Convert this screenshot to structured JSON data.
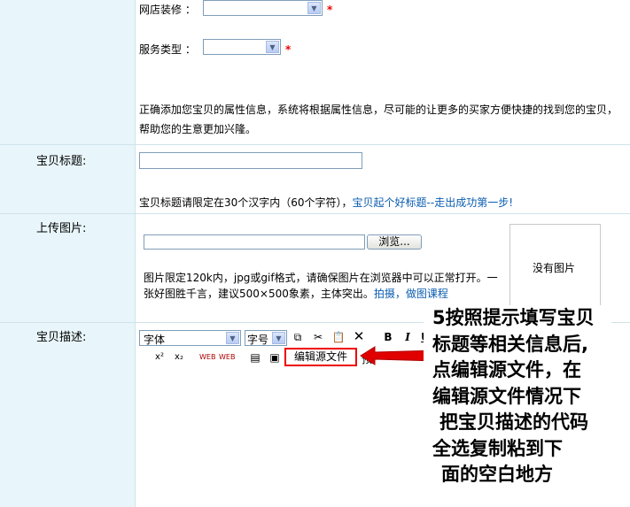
{
  "shop_decor": {
    "label": "网店装修 ：",
    "required": "*"
  },
  "service_type": {
    "label": "服务类型 ：",
    "required": "*"
  },
  "attr_hint_1": "正确添加您宝贝的属性信息，系统将根据属性信息，尽可能的让更多的买家方便快捷的找到您的宝贝，",
  "attr_hint_2": "帮助您的生意更加兴隆。",
  "title_section": {
    "label": "宝贝标题:",
    "hint": "宝贝标题请限定在30个汉字内（60个字符），",
    "link": "宝贝起个好标题--走出成功第一步!"
  },
  "upload_section": {
    "label": "上传图片:",
    "browse_button": "浏览...",
    "hint_1": "图片限定120k内，jpg或gif格式，请确保图片在浏览器中可以正常打开。一",
    "hint_2": "张好图胜千言，建议500×500象素，主体突出。",
    "link": "拍摄，做图课程",
    "no_image": "没有图片"
  },
  "desc_section": {
    "label": "宝贝描述:",
    "font_select": "字体",
    "size_select": "字号",
    "edit_source_button": "编辑源文件",
    "preview_partial": "预"
  },
  "annotation": {
    "lines": [
      "5按照提示填写宝贝",
      "标题等相关信息后,",
      "点编辑源文件，在",
      "编辑源文件情况下",
      "把宝贝描述的代码",
      "全选复制粘到下",
      "面的空白地方"
    ],
    "arrow_color": "#e00000"
  }
}
